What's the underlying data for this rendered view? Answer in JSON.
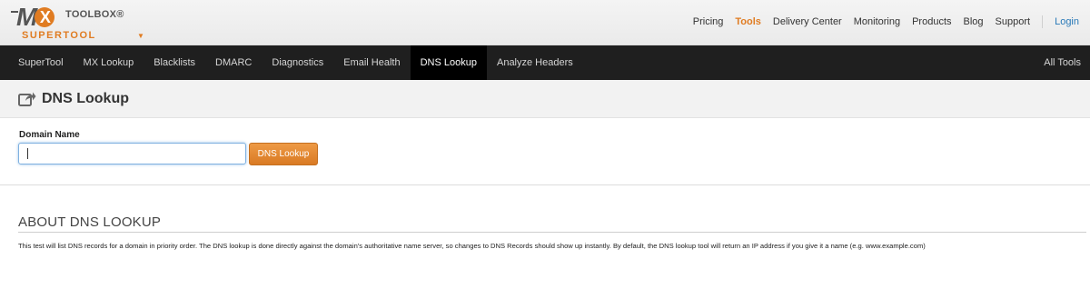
{
  "brand": {
    "logo_mx": "M",
    "logo_x": "X",
    "logo_toolbox": "TOOLBOX®",
    "logo_super": "SUPERTOOL"
  },
  "topnav": {
    "items": [
      {
        "label": "Pricing",
        "active": false
      },
      {
        "label": "Tools",
        "active": true
      },
      {
        "label": "Delivery Center",
        "active": false
      },
      {
        "label": "Monitoring",
        "active": false
      },
      {
        "label": "Products",
        "active": false
      },
      {
        "label": "Blog",
        "active": false
      },
      {
        "label": "Support",
        "active": false
      }
    ],
    "login": "Login"
  },
  "toolnav": {
    "tabs": [
      {
        "label": "SuperTool"
      },
      {
        "label": "MX Lookup"
      },
      {
        "label": "Blacklists"
      },
      {
        "label": "DMARC"
      },
      {
        "label": "Diagnostics"
      },
      {
        "label": "Email Health"
      },
      {
        "label": "DNS Lookup"
      },
      {
        "label": "Analyze Headers"
      }
    ],
    "active_tab": "DNS Lookup",
    "all_tools": "All Tools"
  },
  "page": {
    "title": "DNS Lookup",
    "icon": "share-icon"
  },
  "form": {
    "label": "Domain Name",
    "input_value": "",
    "button_label": "DNS Lookup"
  },
  "about": {
    "heading": "ABOUT DNS LOOKUP",
    "text": "This test will list DNS records for a domain in priority order. The DNS lookup is done directly against the domain's authoritative name server, so changes to DNS Records should show up instantly. By default, the DNS lookup tool will return an IP address if you give it a name (e.g. www.example.com)"
  },
  "colors": {
    "accent": "#e07c22",
    "nav_bg": "#1f1f1f",
    "link": "#2a7ab8"
  }
}
